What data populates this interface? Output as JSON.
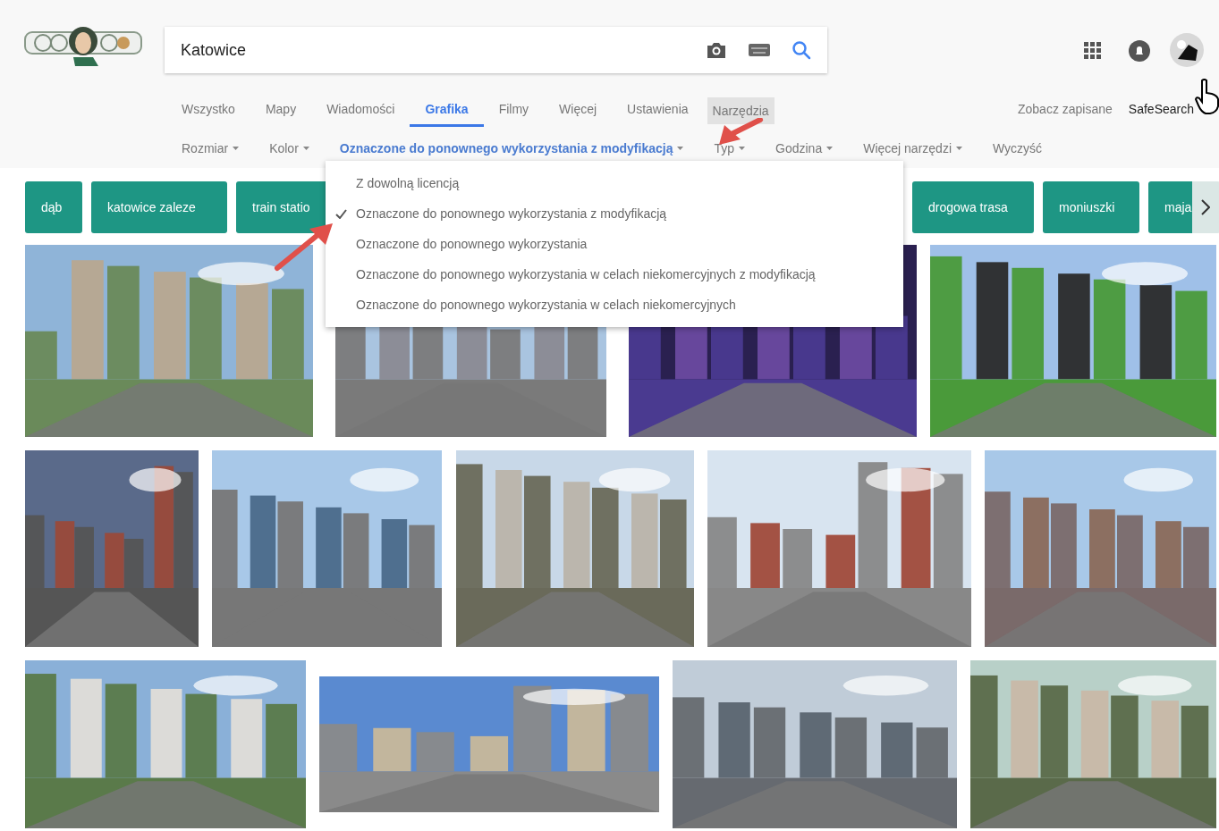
{
  "search": {
    "value": "Katowice"
  },
  "nav_tabs": [
    {
      "label": "Wszystko",
      "selected": false
    },
    {
      "label": "Mapy",
      "selected": false
    },
    {
      "label": "Wiadomości",
      "selected": false
    },
    {
      "label": "Grafika",
      "selected": true
    },
    {
      "label": "Filmy",
      "selected": false
    },
    {
      "label": "Więcej",
      "selected": false
    },
    {
      "label": "Ustawienia",
      "selected": false
    }
  ],
  "tools_button": {
    "label": "Narzędzia",
    "pressed": true
  },
  "right_links": [
    "Zobacz zapisane",
    "SafeSearch"
  ],
  "filters": [
    {
      "label": "Rozmiar",
      "dropdown": true,
      "selected": false
    },
    {
      "label": "Kolor",
      "dropdown": true,
      "selected": false
    },
    {
      "label": "Oznaczone do ponownego wykorzystania z modyfikacją",
      "dropdown": true,
      "selected": true
    },
    {
      "label": "Typ",
      "dropdown": true,
      "selected": false
    },
    {
      "label": "Godzina",
      "dropdown": true,
      "selected": false
    },
    {
      "label": "Więcej narzędzi",
      "dropdown": true,
      "selected": false
    },
    {
      "label": "Wyczyść",
      "dropdown": false,
      "selected": false
    }
  ],
  "license_menu": [
    {
      "label": "Z dowolną licencją",
      "selected": false
    },
    {
      "label": "Oznaczone do ponownego wykorzystania z modyfikacją",
      "selected": true
    },
    {
      "label": "Oznaczone do ponownego wykorzystania",
      "selected": false
    },
    {
      "label": "Oznaczone do ponownego wykorzystania w celach niekomercyjnych z modyfikacją",
      "selected": false
    },
    {
      "label": "Oznaczone do ponownego wykorzystania w celach niekomercyjnych",
      "selected": false
    }
  ],
  "related_chips": [
    {
      "label": "dąb"
    },
    {
      "label": "katowice zaleze"
    },
    {
      "label": "train statio"
    },
    {
      "label": "drogowa trasa"
    },
    {
      "label": "moniuszki"
    },
    {
      "label": "maja"
    }
  ]
}
